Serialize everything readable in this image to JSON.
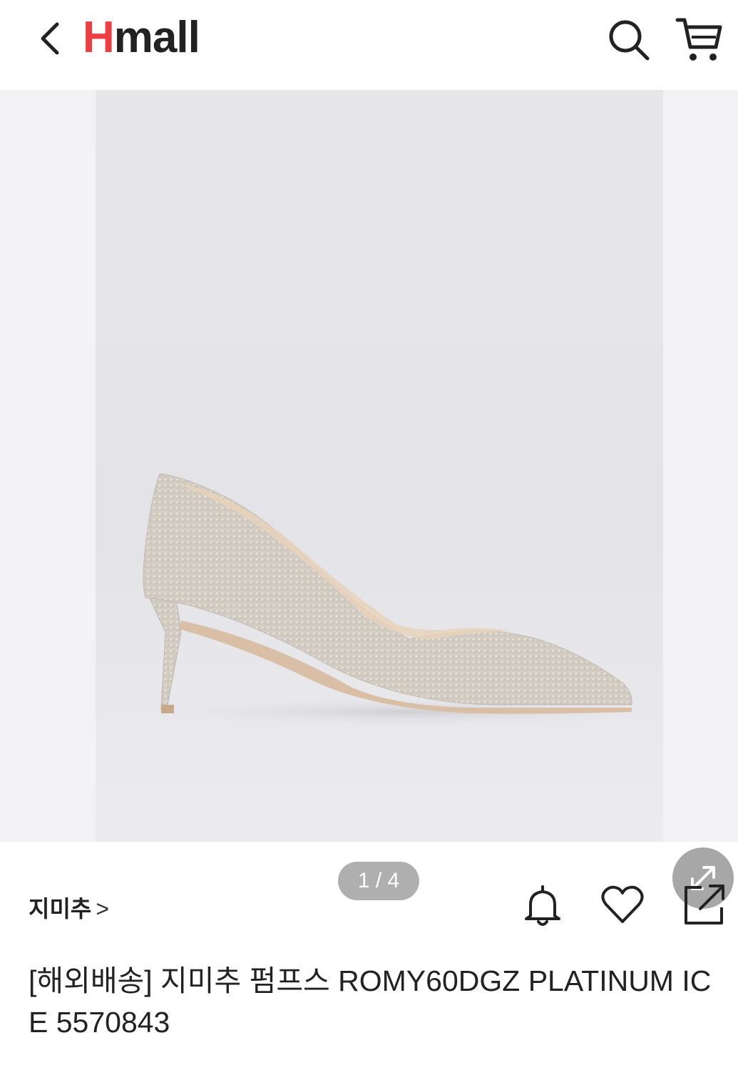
{
  "header": {
    "logo_h": "H",
    "logo_rest": "mall",
    "brand_color": "#ef3e42"
  },
  "icons": {
    "back": "chevron-left-icon",
    "search": "search-icon",
    "cart": "cart-icon",
    "expand": "expand-icon",
    "alarm": "bell-icon",
    "wish": "heart-icon",
    "share": "share-icon"
  },
  "gallery": {
    "counter": "1 / 4",
    "current_index": 1,
    "total": 4
  },
  "product": {
    "brand_label": "지미추",
    "brand_chevron": ">",
    "title": "[해외배송] 지미추 펌프스 ROMY60DGZ PLATINUM ICE 5570843"
  }
}
